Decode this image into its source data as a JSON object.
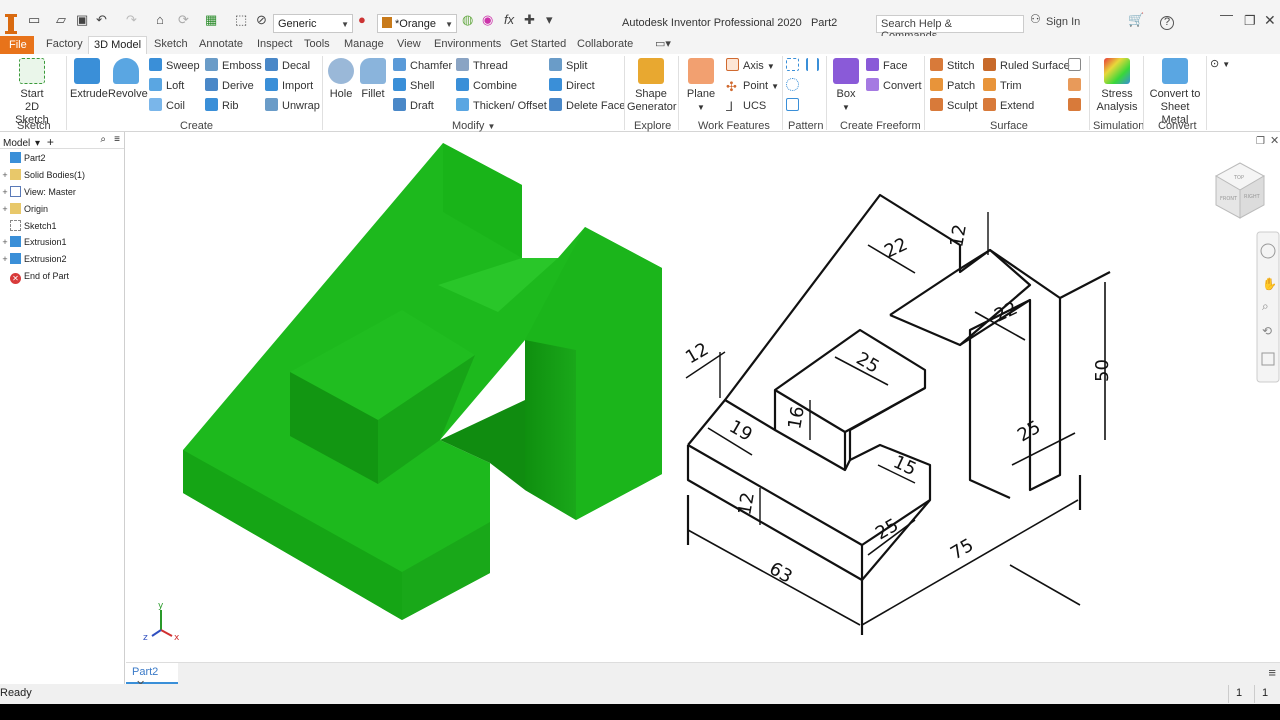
{
  "window": {
    "title": "Autodesk Inventor Professional 2020",
    "document": "Part2"
  },
  "quick_access": {
    "material": "Generic",
    "appearance": "*Orange",
    "search_placeholder": "Search Help & Commands...",
    "sign_in": "Sign In",
    "help": "?"
  },
  "menu_tabs": [
    "File",
    "Factory",
    "3D Model",
    "Sketch",
    "Annotate",
    "Inspect",
    "Tools",
    "Manage",
    "View",
    "Environments",
    "Get Started",
    "Collaborate"
  ],
  "active_tab": "3D Model",
  "ribbon": {
    "sketch": {
      "start_line1": "Start",
      "start_line2": "2D Sketch",
      "panel": "Sketch"
    },
    "create": {
      "extrude": "Extrude",
      "revolve": "Revolve",
      "sweep": "Sweep",
      "loft": "Loft",
      "coil": "Coil",
      "emboss": "Emboss",
      "derive": "Derive",
      "rib": "Rib",
      "decal": "Decal",
      "import": "Import",
      "unwrap": "Unwrap",
      "panel": "Create"
    },
    "modify": {
      "hole": "Hole",
      "fillet": "Fillet",
      "chamfer": "Chamfer",
      "shell": "Shell",
      "draft": "Draft",
      "thread": "Thread",
      "combine": "Combine",
      "thicken": "Thicken/ Offset",
      "split": "Split",
      "direct": "Direct",
      "delete_face": "Delete Face",
      "panel": "Modify"
    },
    "explore": {
      "line1": "Shape",
      "line2": "Generator",
      "panel": "Explore"
    },
    "work_features": {
      "plane": "Plane",
      "axis": "Axis",
      "point": "Point",
      "ucs": "UCS",
      "panel": "Work Features"
    },
    "pattern": {
      "panel": "Pattern"
    },
    "freeform": {
      "box": "Box",
      "face": "Face",
      "convert": "Convert",
      "panel": "Create Freeform"
    },
    "surface": {
      "stitch": "Stitch",
      "patch": "Patch",
      "sculpt": "Sculpt",
      "ruled": "Ruled Surface",
      "trim": "Trim",
      "extend": "Extend",
      "panel": "Surface"
    },
    "simulation": {
      "line1": "Stress",
      "line2": "Analysis",
      "panel": "Simulation"
    },
    "convert": {
      "line1": "Convert to",
      "line2": "Sheet Metal",
      "panel": "Convert"
    }
  },
  "browser": {
    "header": "Model",
    "nodes": [
      {
        "label": "Part2"
      },
      {
        "label": "Solid Bodies(1)"
      },
      {
        "label": "View: Master"
      },
      {
        "label": "Origin"
      },
      {
        "label": "Sketch1"
      },
      {
        "label": "Extrusion1"
      },
      {
        "label": "Extrusion2"
      },
      {
        "label": "End of Part"
      }
    ]
  },
  "drawing": {
    "dims": [
      "22",
      "12",
      "22",
      "12",
      "25",
      "50",
      "19",
      "16",
      "25",
      "15",
      "12",
      "25",
      "63",
      "75"
    ]
  },
  "viewcube": {
    "top": "TOP",
    "front": "FRONT",
    "right": "RIGHT"
  },
  "triad": {
    "x": "x",
    "y": "y",
    "z": "z"
  },
  "doc_tab": {
    "label": "Part2"
  },
  "status": {
    "text": "Ready",
    "count1": "1",
    "count2": "1"
  },
  "colors": {
    "accent": "#e8731a",
    "model_green": "#1fb51f",
    "blue_icon": "#3a8fd8"
  }
}
